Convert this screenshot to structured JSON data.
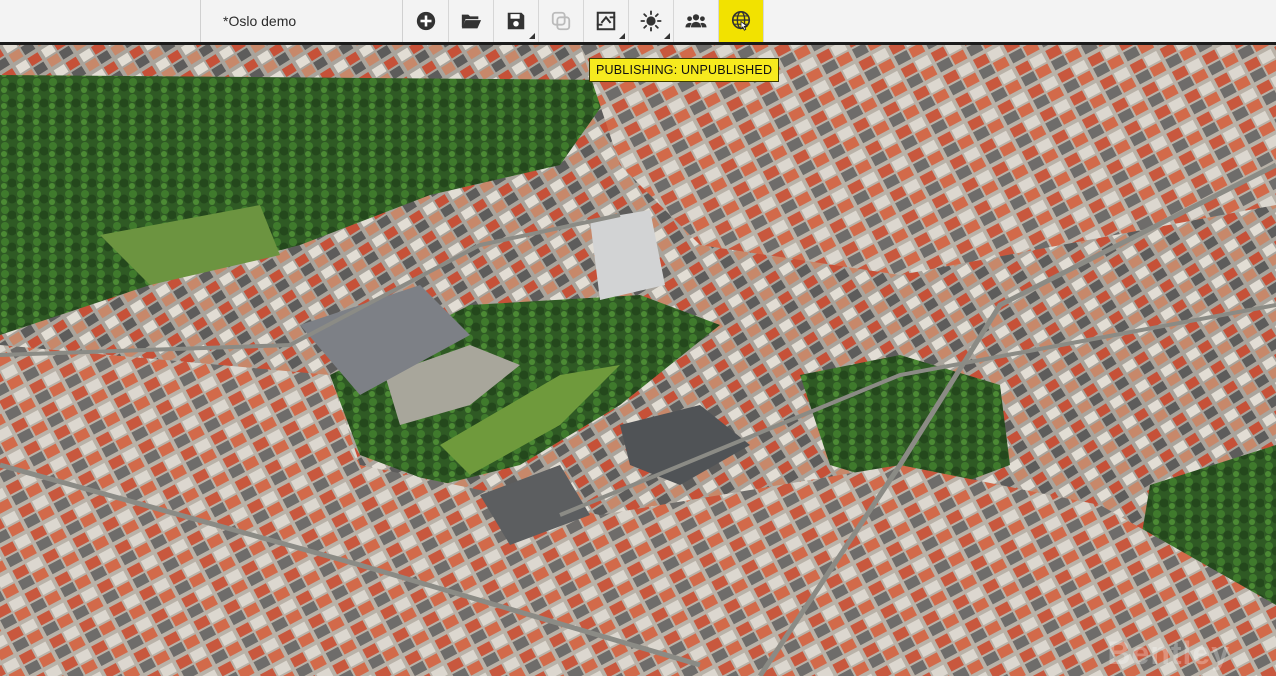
{
  "document": {
    "title": "*Oslo demo"
  },
  "toolbar": {
    "buttons": [
      {
        "name": "add-icon"
      },
      {
        "name": "open-folder-icon"
      },
      {
        "name": "save-icon",
        "has_menu": true
      },
      {
        "name": "duplicate-icon",
        "disabled": true
      },
      {
        "name": "swap-view-icon",
        "has_menu": true
      },
      {
        "name": "sun-icon",
        "has_menu": true
      },
      {
        "name": "users-icon"
      },
      {
        "name": "publish-globe-icon",
        "active": true
      }
    ]
  },
  "tooltip": {
    "text": "PUBLISHING: UNPUBLISHED"
  },
  "watermark": {
    "text": "Bentley"
  },
  "colors": {
    "accent": "#f2e200",
    "toolbar_bg": "#f3f3f3",
    "toolbar_border": "#1b1b1b"
  }
}
